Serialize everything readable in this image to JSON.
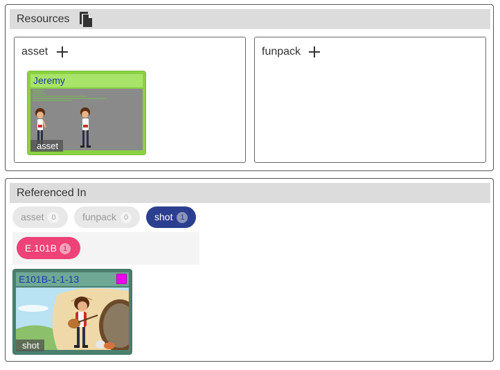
{
  "resources": {
    "title": "Resources",
    "groups": [
      {
        "label": "asset"
      },
      {
        "label": "funpack"
      }
    ],
    "asset_card": {
      "title": "Jeremy",
      "tag": "asset"
    }
  },
  "referenced": {
    "title": "Referenced In",
    "filters": [
      {
        "label": "asset",
        "count": "0"
      },
      {
        "label": "funpack",
        "count": "0"
      },
      {
        "label": "shot",
        "count": "1"
      }
    ],
    "subfilter": {
      "label": "E.101B",
      "count": "1"
    },
    "shot_card": {
      "title": "E101B-1-1-13",
      "tag": "shot",
      "flag_color": "#ee00ee"
    }
  },
  "colors": {
    "asset_card": "#8bd143",
    "shot_pill": "#2c3e8f",
    "episode_pill": "#ef4278",
    "shot_card": "#4a7f6e"
  }
}
